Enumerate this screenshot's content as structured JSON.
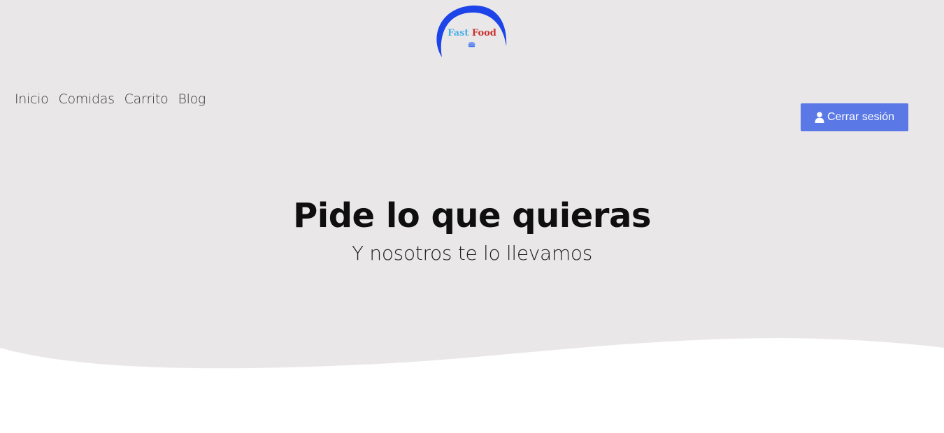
{
  "logo": {
    "word1": "Fast",
    "word2": "Food",
    "icon": "burger-icon",
    "arc_color": "#1d44e8",
    "word1_color": "#4ab0e6",
    "word2_color": "#c8322f"
  },
  "nav": {
    "items": [
      {
        "label": "Inicio"
      },
      {
        "label": "Comidas"
      },
      {
        "label": "Carrito"
      },
      {
        "label": "Blog"
      }
    ]
  },
  "account": {
    "logout_label": "Cerrar sesión",
    "icon": "user-icon",
    "button_color": "#5a78e6"
  },
  "hero": {
    "title": "Pide lo que quieras",
    "subtitle": "Y nosotros te lo llevamos",
    "background": "#eae7e9"
  }
}
